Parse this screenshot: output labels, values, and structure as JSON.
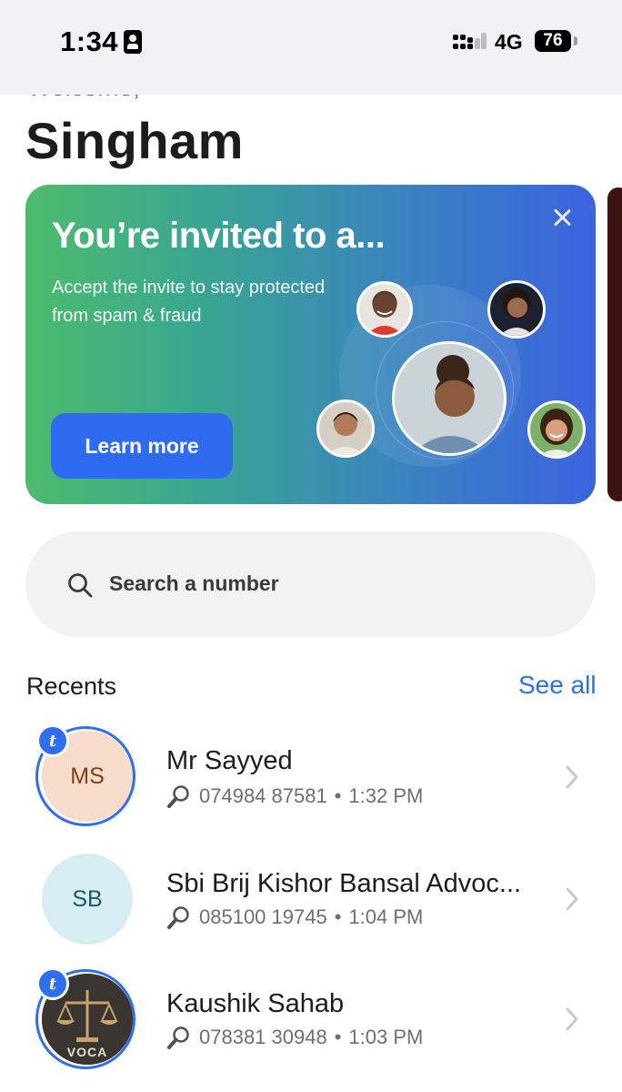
{
  "status_bar": {
    "time": "1:34",
    "network": "4G",
    "battery": "76"
  },
  "header": {
    "welcome": "Welcome,",
    "name": "Singham"
  },
  "banner": {
    "title": "You’re invited to a...",
    "subtitle_line1": "Accept the invite to stay protected",
    "subtitle_line2": "from spam & fraud",
    "button": "Learn more"
  },
  "search": {
    "placeholder": "Search a number"
  },
  "recents": {
    "title": "Recents",
    "see_all": "See all",
    "items": [
      {
        "initials": "MS",
        "name": "Mr Sayyed",
        "number": "074984 87581",
        "time": "1:32 PM",
        "badge": "t",
        "avatar_bg": "#f7dccb",
        "initials_color": "#8a3b12"
      },
      {
        "initials": "SB",
        "name": "Sbi Brij Kishor Bansal Advoc...",
        "number": "085100 19745",
        "time": "1:04 PM",
        "avatar_bg": "#d6eef2",
        "initials_color": "#1f5563"
      },
      {
        "name": "Kaushik Sahab",
        "number": "078381 30948",
        "time": "1:03 PM",
        "badge": "t",
        "avatar_text": "VOCA"
      }
    ]
  },
  "colors": {
    "accent": "#2e6ff0",
    "banner_start": "#4dbb6d",
    "banner_end": "#3b63e0"
  }
}
